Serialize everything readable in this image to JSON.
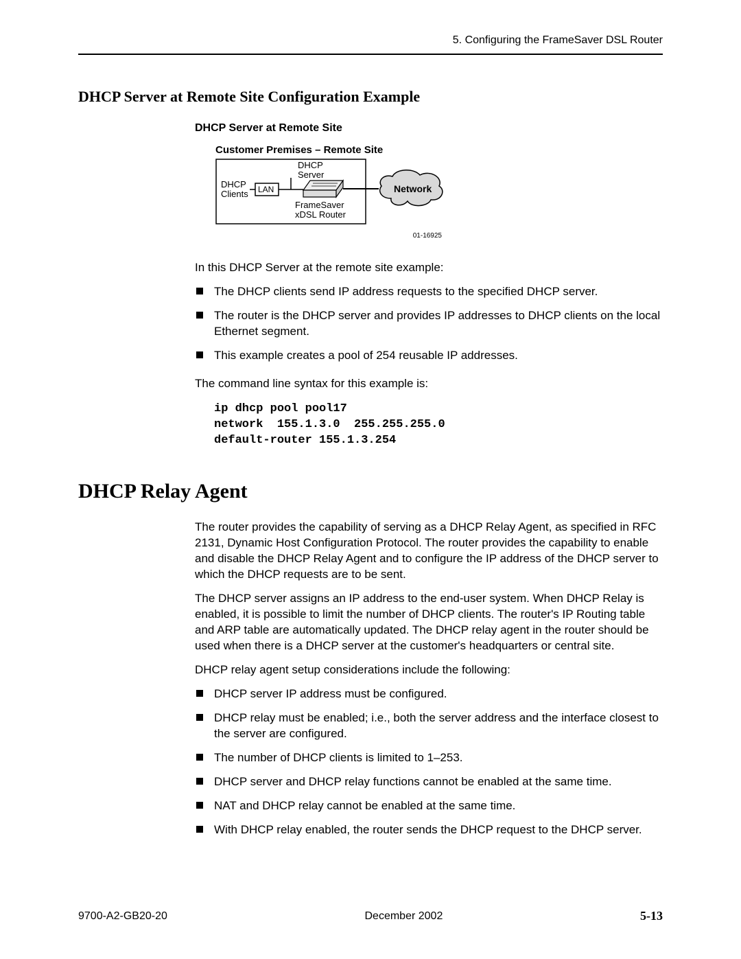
{
  "header": {
    "chapter_label": "5. Configuring the FrameSaver DSL Router"
  },
  "section1": {
    "heading": "DHCP Server at Remote Site Configuration Example",
    "diagram": {
      "title": "DHCP Server at Remote Site",
      "subtitle": "Customer Premises – Remote Site",
      "labels": {
        "dhcp_clients": "DHCP\nClients",
        "lan": "LAN",
        "dhcp_server": "DHCP\nServer",
        "router": "FrameSaver\nxDSL Router",
        "network": "Network"
      },
      "id": "01-16925"
    },
    "intro": "In this DHCP Server at the remote site example:",
    "bullets": [
      "The DHCP clients send IP address requests to the specified DHCP server.",
      "The router is the DHCP server and provides IP addresses to DHCP clients on the local Ethernet segment.",
      "This example creates a pool of 254 reusable IP addresses."
    ],
    "syntax_intro": "The command line syntax for this example is:",
    "code": "ip dhcp pool pool17\nnetwork  155.1.3.0  255.255.255.0\ndefault-router 155.1.3.254"
  },
  "section2": {
    "heading": "DHCP Relay Agent",
    "paras": [
      "The router provides the capability of serving as a DHCP Relay Agent, as specified in RFC 2131, Dynamic Host Configuration Protocol. The router provides the capability to enable and disable the DHCP Relay Agent and to configure the IP address of the DHCP server to which the DHCP requests are to be sent.",
      "The DHCP server assigns an IP address to the end-user system. When DHCP Relay is enabled, it is possible to limit the number of DHCP clients. The router's IP Routing table and ARP table are automatically updated. The DHCP relay agent in the router should be used when there is a DHCP server at the customer's headquarters or central site.",
      "DHCP relay agent setup considerations include the following:"
    ],
    "bullets": [
      "DHCP server IP address must be configured.",
      "DHCP relay must be enabled; i.e., both the server address and the interface closest to the server are configured.",
      "The number of DHCP clients is limited to 1–253.",
      "DHCP server and DHCP relay functions cannot be enabled at the same time.",
      "NAT and DHCP relay cannot be enabled at the same time.",
      "With DHCP relay enabled, the router sends the DHCP request to the DHCP server."
    ]
  },
  "footer": {
    "doc_id": "9700-A2-GB20-20",
    "date": "December 2002",
    "page": "5-13"
  }
}
